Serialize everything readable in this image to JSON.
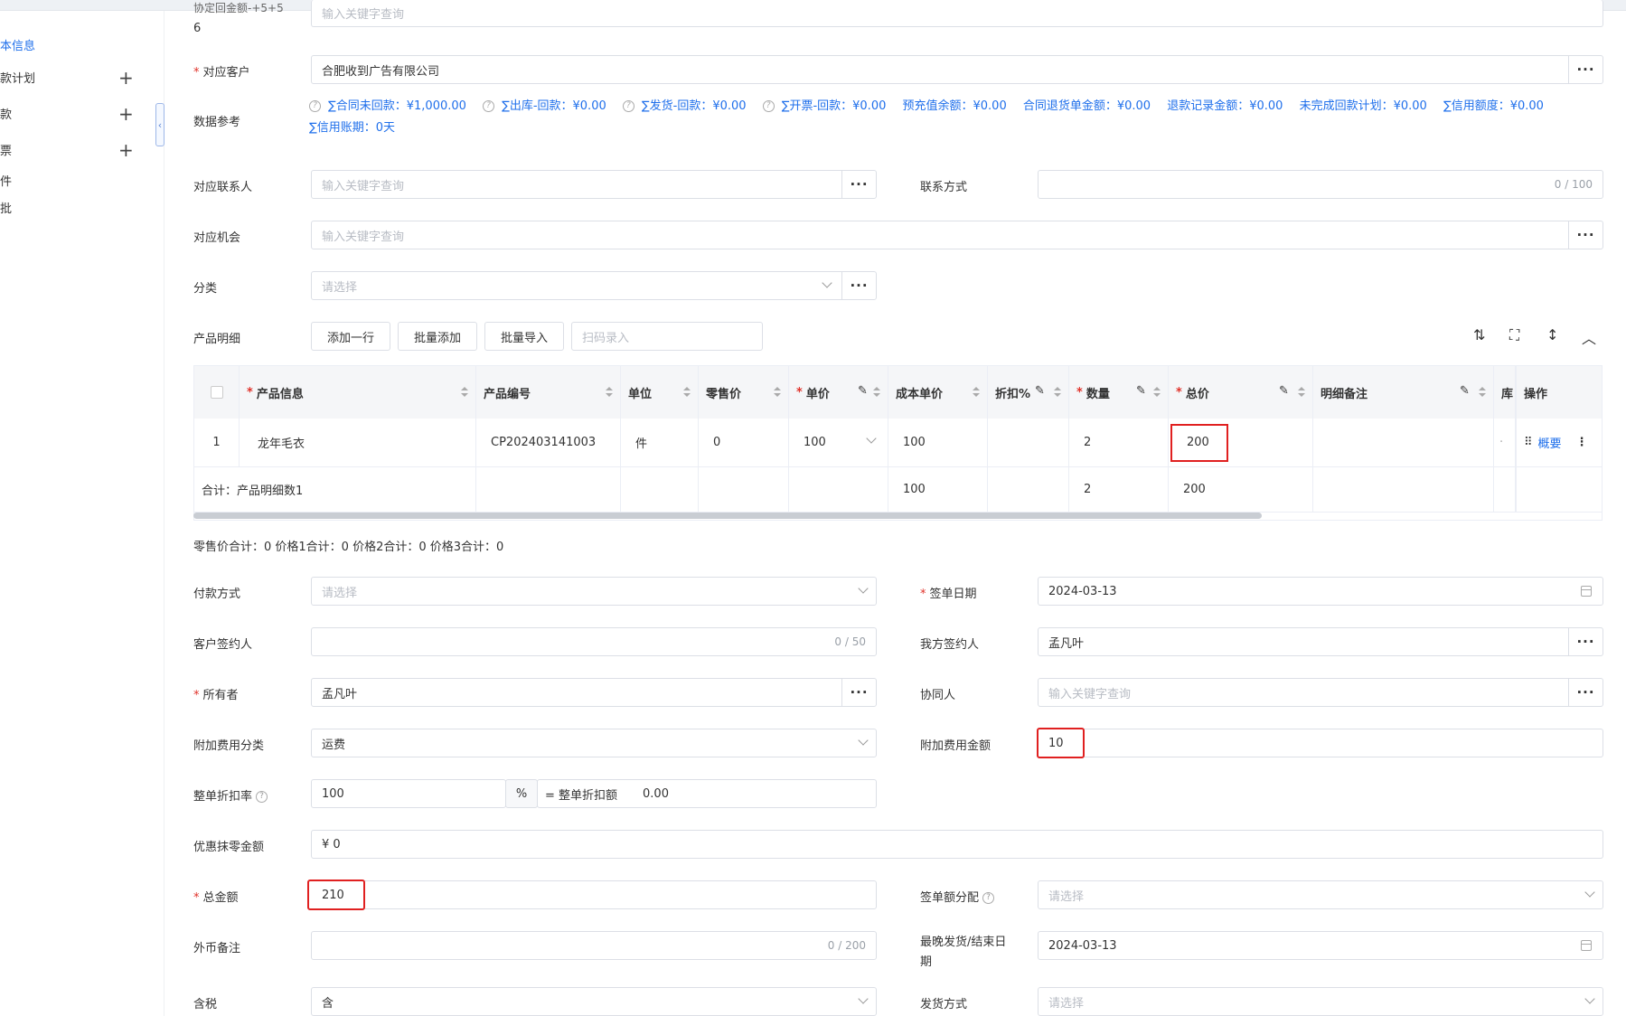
{
  "sidebar": {
    "items": [
      {
        "label": "本信息"
      },
      {
        "label": "款计划"
      },
      {
        "label": "款"
      },
      {
        "label": "票"
      },
      {
        "label": "件"
      },
      {
        "label": "批"
      }
    ]
  },
  "top_field": {
    "label_line1": "协定回金额-+5+5",
    "label_line2": "6",
    "placeholder": "输入关键字查询"
  },
  "customer": {
    "label": "对应客户",
    "value": "合肥收到广告有限公司"
  },
  "data_ref": {
    "label": "数据参考",
    "items": [
      "∑合同未回款：¥1,000.00",
      "∑出库-回款：¥0.00",
      "∑发货-回款：¥0.00",
      "∑开票-回款：¥0.00",
      "预充值余额：¥0.00",
      "合同退货单金额：¥0.00",
      "退款记录金额：¥0.00",
      "未完成回款计划：¥0.00",
      "∑信用额度：¥0.00",
      "∑信用账期：0天"
    ]
  },
  "contact": {
    "label": "对应联系人",
    "placeholder": "输入关键字查询"
  },
  "contact_method": {
    "label": "联系方式",
    "count": "0 / 100"
  },
  "opportunity": {
    "label": "对应机会",
    "placeholder": "输入关键字查询"
  },
  "category": {
    "label": "分类",
    "placeholder": "请选择"
  },
  "products": {
    "label": "产品明细",
    "buttons": [
      "添加一行",
      "批量添加",
      "批量导入"
    ],
    "scan_placeholder": "扫码录入"
  },
  "table": {
    "headers": [
      "产品信息",
      "产品编号",
      "单位",
      "零售价",
      "单价",
      "成本单价",
      "折扣%",
      "数量",
      "总价",
      "明细备注",
      "库",
      "操作"
    ],
    "row": {
      "index": "1",
      "name": "龙年毛衣",
      "code": "CP202403141003",
      "unit": "件",
      "retail": "0",
      "price": "100",
      "cost": "100",
      "qty": "2",
      "total": "200",
      "action": "概要"
    },
    "summary": {
      "label": "合计：产品明细数1",
      "cost": "100",
      "qty": "2",
      "total": "200"
    }
  },
  "price_totals": "零售价合计：0  价格1合计：0  价格2合计：0  价格3合计：0",
  "payment_method": {
    "label": "付款方式",
    "placeholder": "请选择"
  },
  "sign_date": {
    "label": "签单日期",
    "value": "2024-03-13"
  },
  "customer_signer": {
    "label": "客户签约人",
    "count": "0 / 50"
  },
  "our_signer": {
    "label": "我方签约人",
    "value": "孟凡叶"
  },
  "owner": {
    "label": "所有者",
    "value": "孟凡叶"
  },
  "collaborator": {
    "label": "协同人",
    "placeholder": "输入关键字查询"
  },
  "extra_fee_cat": {
    "label": "附加费用分类",
    "value": "运费"
  },
  "extra_fee_amt": {
    "label": "附加费用金额",
    "value": "10"
  },
  "discount_rate": {
    "label": "整单折扣率",
    "value": "100",
    "pct": "%",
    "eq_label": "= 整单折扣额",
    "eq_value": "0.00"
  },
  "rounding": {
    "label": "优惠抹零金额",
    "value": "¥  0"
  },
  "total_amount": {
    "label": "总金额",
    "value": "210"
  },
  "sign_alloc": {
    "label": "签单额分配",
    "placeholder": "请选择"
  },
  "fx_note": {
    "label": "外币备注",
    "count": "0 / 200"
  },
  "latest_ship": {
    "label_line1": "最晚发货/结束日",
    "label_line2": "期",
    "value": "2024-03-13"
  },
  "tax": {
    "label": "含税",
    "value": "含"
  },
  "ship_method": {
    "label": "发货方式",
    "placeholder": "请选择"
  }
}
